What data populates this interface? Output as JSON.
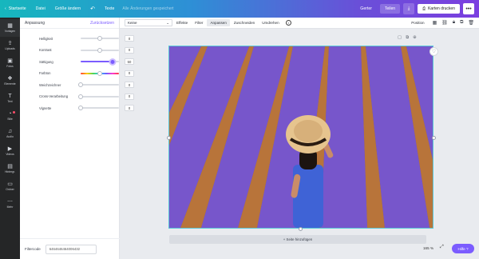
{
  "topbar": {
    "home": "Startseite",
    "file": "Datei",
    "resize": "Größe ändern",
    "undo_icon": "undo-arrow-icon",
    "title_tool": "Texte",
    "save_status": "Alle Änderungen gespeichert",
    "upgrade": "Gerter",
    "share": "Teilen",
    "download_icon": "download-icon",
    "print": "Karten drucken",
    "more": "•••"
  },
  "rail": {
    "items": [
      {
        "label": "Vorlagen",
        "icon": "▦"
      },
      {
        "label": "Uploads",
        "icon": "⇪"
      },
      {
        "label": "Fotos",
        "icon": "▣"
      },
      {
        "label": "Elemente",
        "icon": "❖"
      },
      {
        "label": "Text",
        "icon": "T"
      },
      {
        "label": "Stile",
        "icon": "◔"
      },
      {
        "label": "Audio",
        "icon": "♫"
      },
      {
        "label": "Videos",
        "icon": "▶"
      },
      {
        "label": "Hintergr.",
        "icon": "▤"
      },
      {
        "label": "Ordner",
        "icon": "▭"
      },
      {
        "label": "Mehr",
        "icon": "⋯"
      }
    ]
  },
  "panel": {
    "title": "Anpassung",
    "reset": "Zurücksetzen",
    "sliders": [
      {
        "label": "Helligkeit",
        "value": "0",
        "level": 0.5
      },
      {
        "label": "Kontrast",
        "value": "0",
        "level": 0.5
      },
      {
        "label": "Sättigung",
        "value": "50",
        "level": 0.83
      },
      {
        "label": "Farbton",
        "value": "0",
        "level": 0.5
      },
      {
        "label": "Weichzeichner",
        "value": "0",
        "level": 0.0
      },
      {
        "label": "Cross-Verarbeitung",
        "value": "0",
        "level": 0.0
      },
      {
        "label": "Vignette",
        "value": "0",
        "level": 0.0
      }
    ],
    "filter_label": "Filtercode",
    "filter_code": "6464646464006432"
  },
  "ctx": {
    "select": "Keine",
    "effects": "Effekte",
    "filter": "Filter",
    "adjust": "Anpassen",
    "crop": "Zuschneiden",
    "flip": "Umdrehen",
    "position": "Position"
  },
  "canvas": {
    "add_page": "+ Seite hinzufügen",
    "zoom": "165 %",
    "help": "Hilfe ?"
  },
  "colors": {
    "accent": "#7b5cff",
    "selection": "#5ac8d8"
  }
}
